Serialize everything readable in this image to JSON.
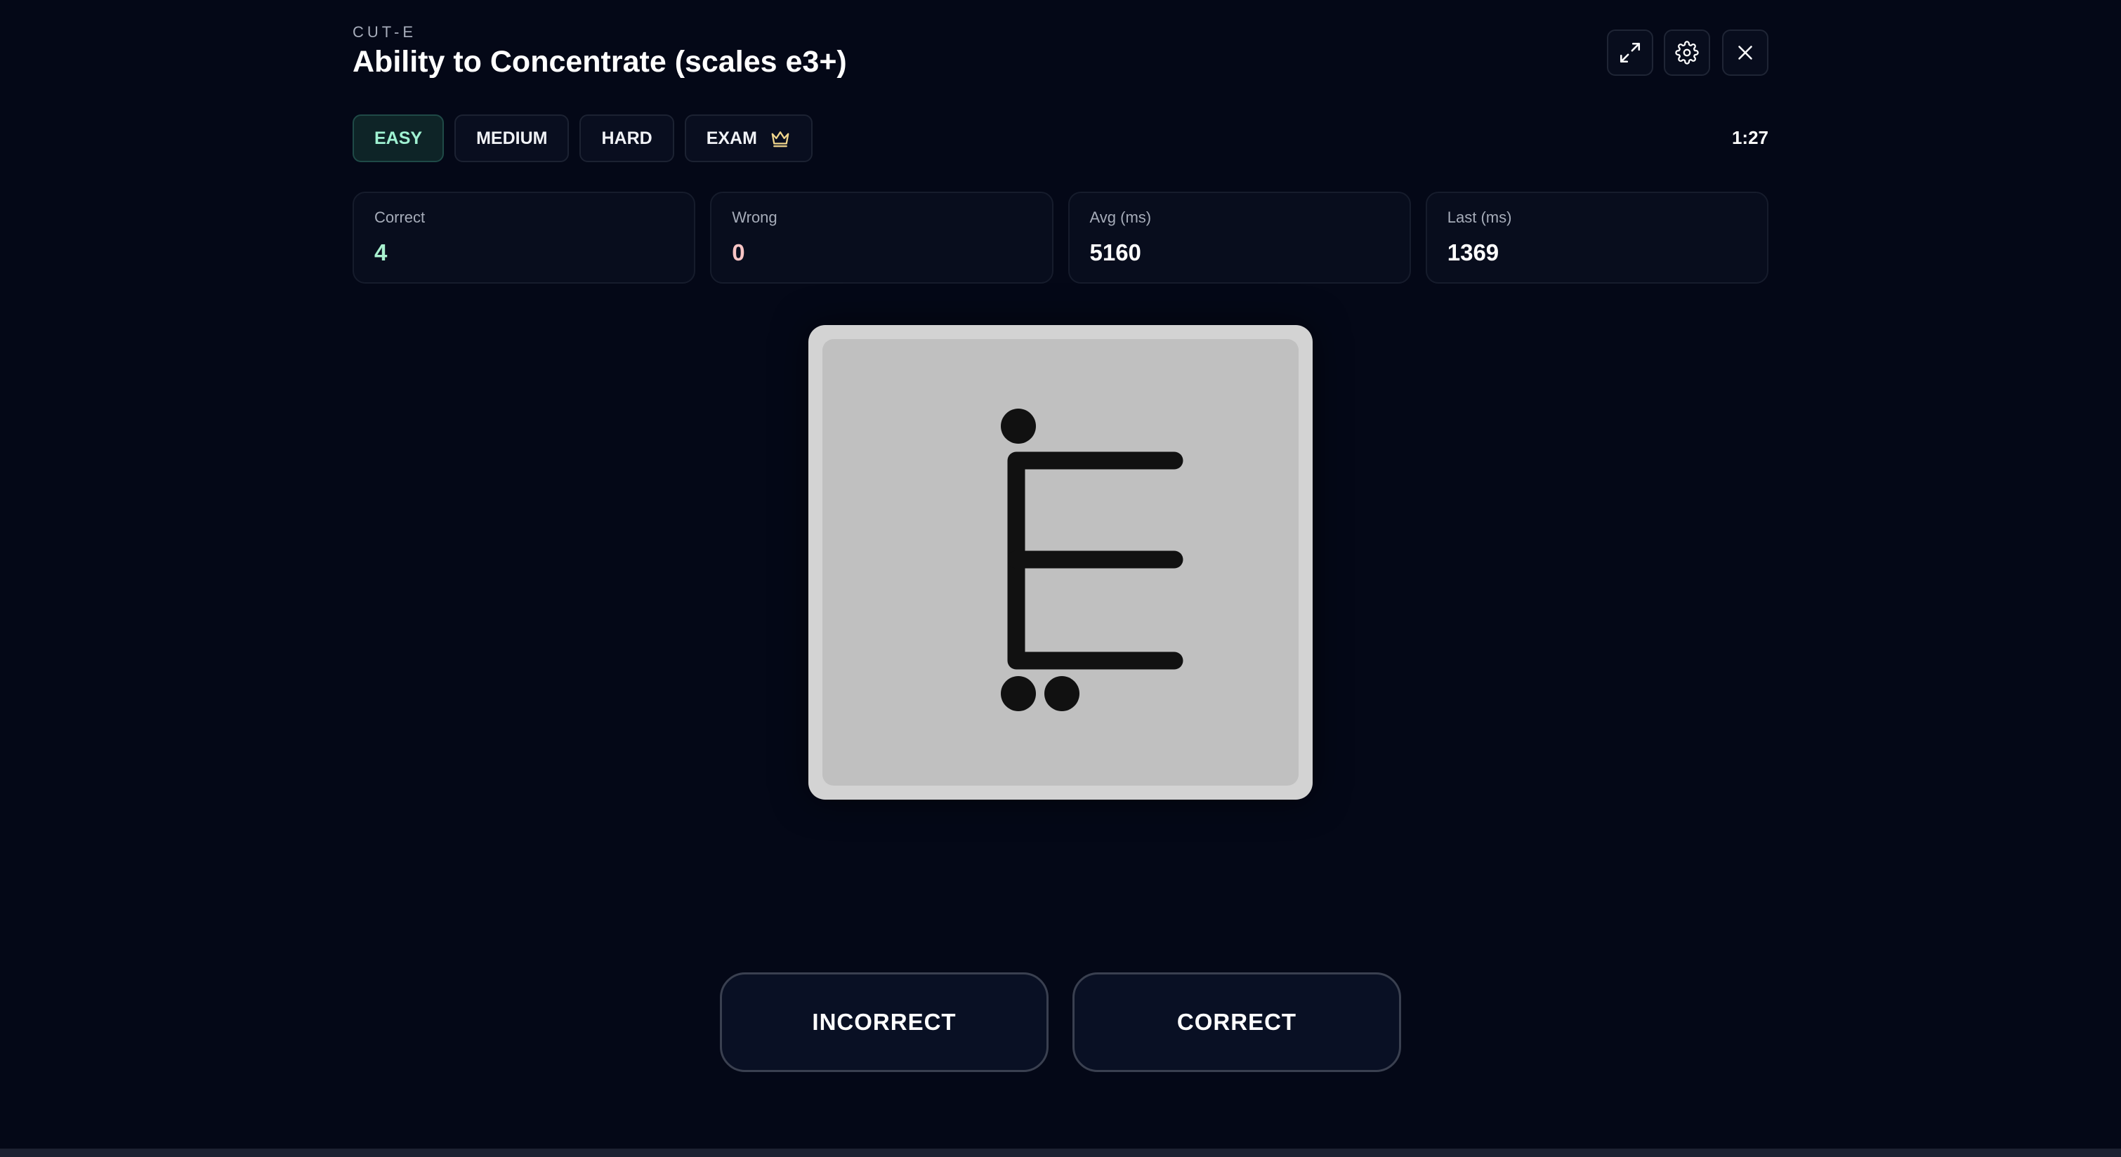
{
  "header": {
    "eyebrow": "CUT-E",
    "title": "Ability to Concentrate (scales e3+)"
  },
  "toolbar": {
    "fullscreen_icon": "expand-icon",
    "settings_icon": "gear-icon",
    "close_icon": "close-icon"
  },
  "difficulty": {
    "tabs": [
      {
        "label": "EASY",
        "active": true
      },
      {
        "label": "MEDIUM",
        "active": false
      },
      {
        "label": "HARD",
        "active": false
      },
      {
        "label": "EXAM",
        "active": false,
        "icon": "crown-icon"
      }
    ]
  },
  "timer": "1:27",
  "stats": [
    {
      "label": "Correct",
      "value": "4"
    },
    {
      "label": "Wrong",
      "value": "0"
    },
    {
      "label": "Avg (ms)",
      "value": "5160"
    },
    {
      "label": "Last (ms)",
      "value": "1369"
    }
  ],
  "stimulus": {
    "letter": "E",
    "dots_above": 1,
    "dots_below": 2
  },
  "answers": {
    "incorrect_label": "INCORRECT",
    "correct_label": "CORRECT"
  },
  "colors": {
    "background": "#040817",
    "accent_green": "#9ff2d2",
    "error_pink": "#f8c5c5",
    "crown_gold": "#f1d68c"
  }
}
